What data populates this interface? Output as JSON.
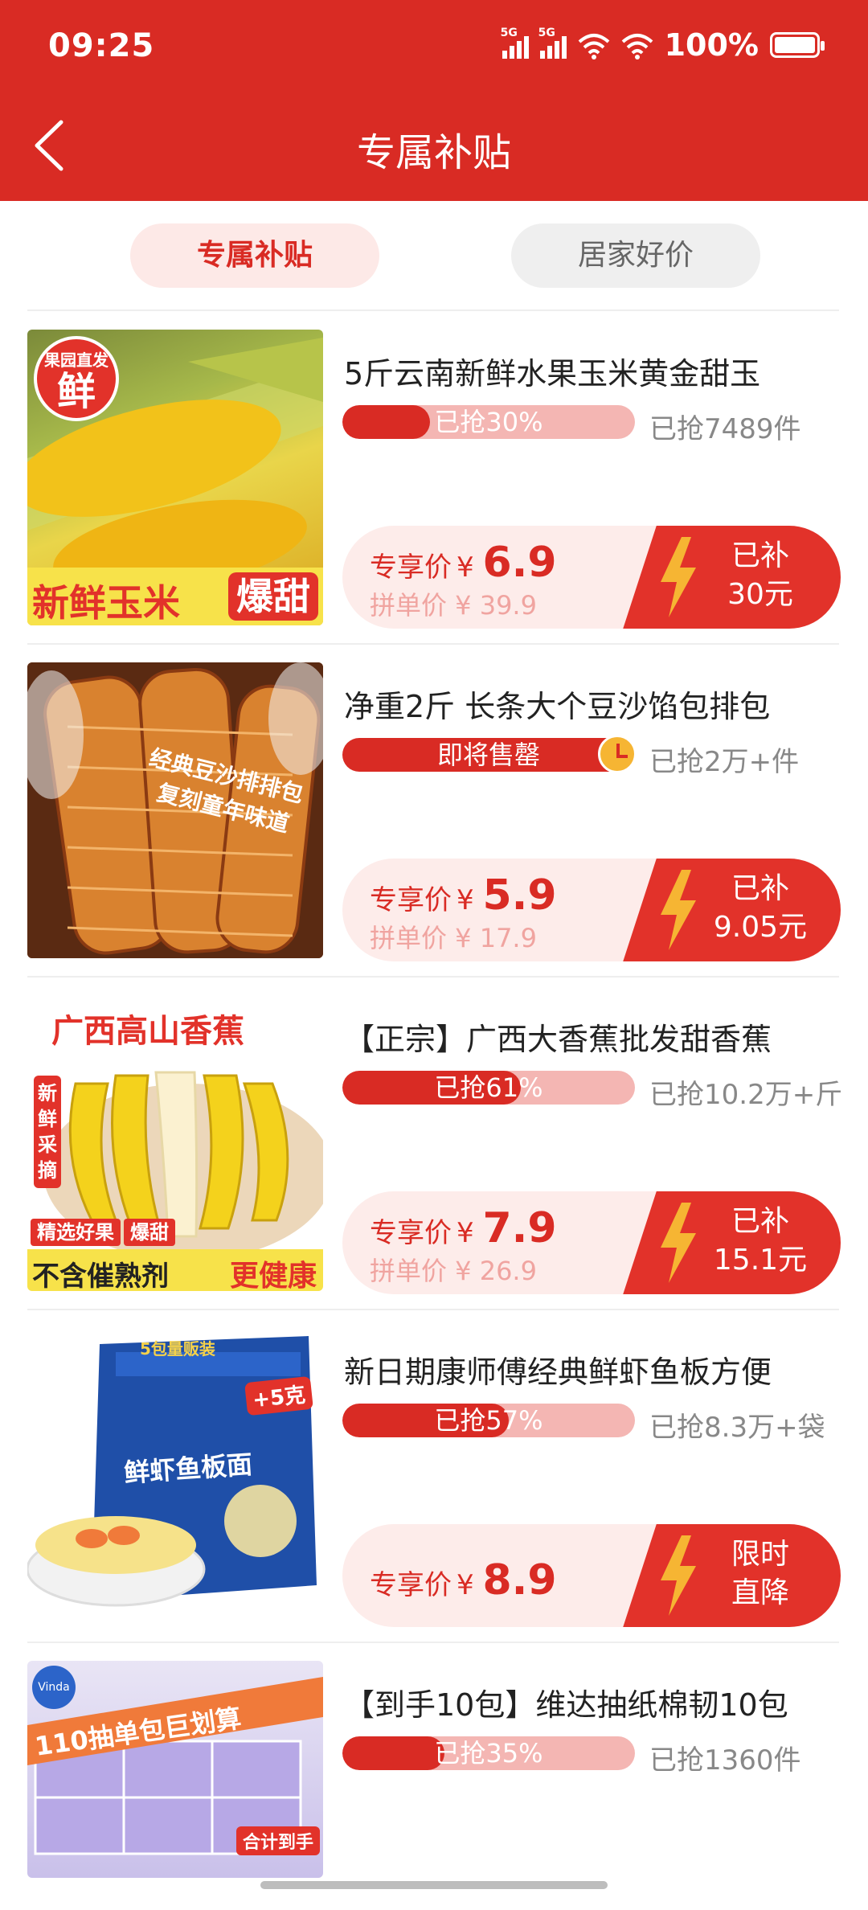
{
  "status_bar": {
    "time": "09:25",
    "signal_1": "5G",
    "signal_2": "5G",
    "battery": "100%"
  },
  "header": {
    "title": "专属补贴"
  },
  "tabs": [
    {
      "label": "专属补贴",
      "active": true
    },
    {
      "label": "居家好价",
      "active": false
    }
  ],
  "colors": {
    "brand_red": "#d92b24",
    "light_pink": "#fdecea",
    "bar_pink": "#f4b6b3"
  },
  "products": [
    {
      "name": "5斤云南新鲜水果玉米黄金甜玉",
      "progress_label": "已抢30%",
      "progress": 0.3,
      "sold": "已抢7489件",
      "vip_label": "专享价",
      "currency": "¥",
      "price": "6.9",
      "group_price": "拼单价 ¥ 39.9",
      "subsidy_line1": "已补",
      "subsidy_line2": "30元",
      "thumb_badge_top_small": "果园直发",
      "thumb_badge_top_big": "鲜",
      "thumb_caption_left": "新鲜玉米",
      "thumb_caption_right": "爆甜"
    },
    {
      "name": "净重2斤 长条大个豆沙馅包排包",
      "progress_label": "即将售罄",
      "progress": 1.0,
      "sold": "已抢2万+件",
      "vip_label": "专享价",
      "currency": "¥",
      "price": "5.9",
      "group_price": "拼单价 ¥ 17.9",
      "subsidy_line1": "已补",
      "subsidy_line2": "9.05元",
      "thumb_overlay_1": "经典豆沙排排包",
      "thumb_overlay_2": "复刻童年味道"
    },
    {
      "name": "【正宗】广西大香蕉批发甜香蕉",
      "progress_label": "已抢61%",
      "progress": 0.61,
      "sold": "已抢10.2万+斤",
      "vip_label": "专享价",
      "currency": "¥",
      "price": "7.9",
      "group_price": "拼单价 ¥ 26.9",
      "subsidy_line1": "已补",
      "subsidy_line2": "15.1元",
      "thumb_title": "广西高山香蕉",
      "thumb_side": "新鲜采摘",
      "thumb_tag_1": "精选好果",
      "thumb_tag_2": "爆甜",
      "thumb_caption_left": "不含催熟剂",
      "thumb_caption_right": "更健康"
    },
    {
      "name": "新日期康师傅经典鲜虾鱼板方便",
      "progress_label": "已抢57%",
      "progress": 0.57,
      "sold": "已抢8.3万+袋",
      "vip_label": "专享价",
      "currency": "¥",
      "price": "8.9",
      "subsidy_line1": "限时",
      "subsidy_line2": "直降",
      "thumb_pack_top": "5包量贩装",
      "thumb_pack_extra": "+5克",
      "thumb_pack_name": "鲜虾鱼板面"
    },
    {
      "name": "【到手10包】维达抽纸棉韧10包",
      "progress_label": "已抢35%",
      "progress": 0.35,
      "sold": "已抢1360件",
      "thumb_logo": "Vinda",
      "thumb_banner": "110抽单包巨划算",
      "thumb_corner": "合计到手"
    }
  ]
}
